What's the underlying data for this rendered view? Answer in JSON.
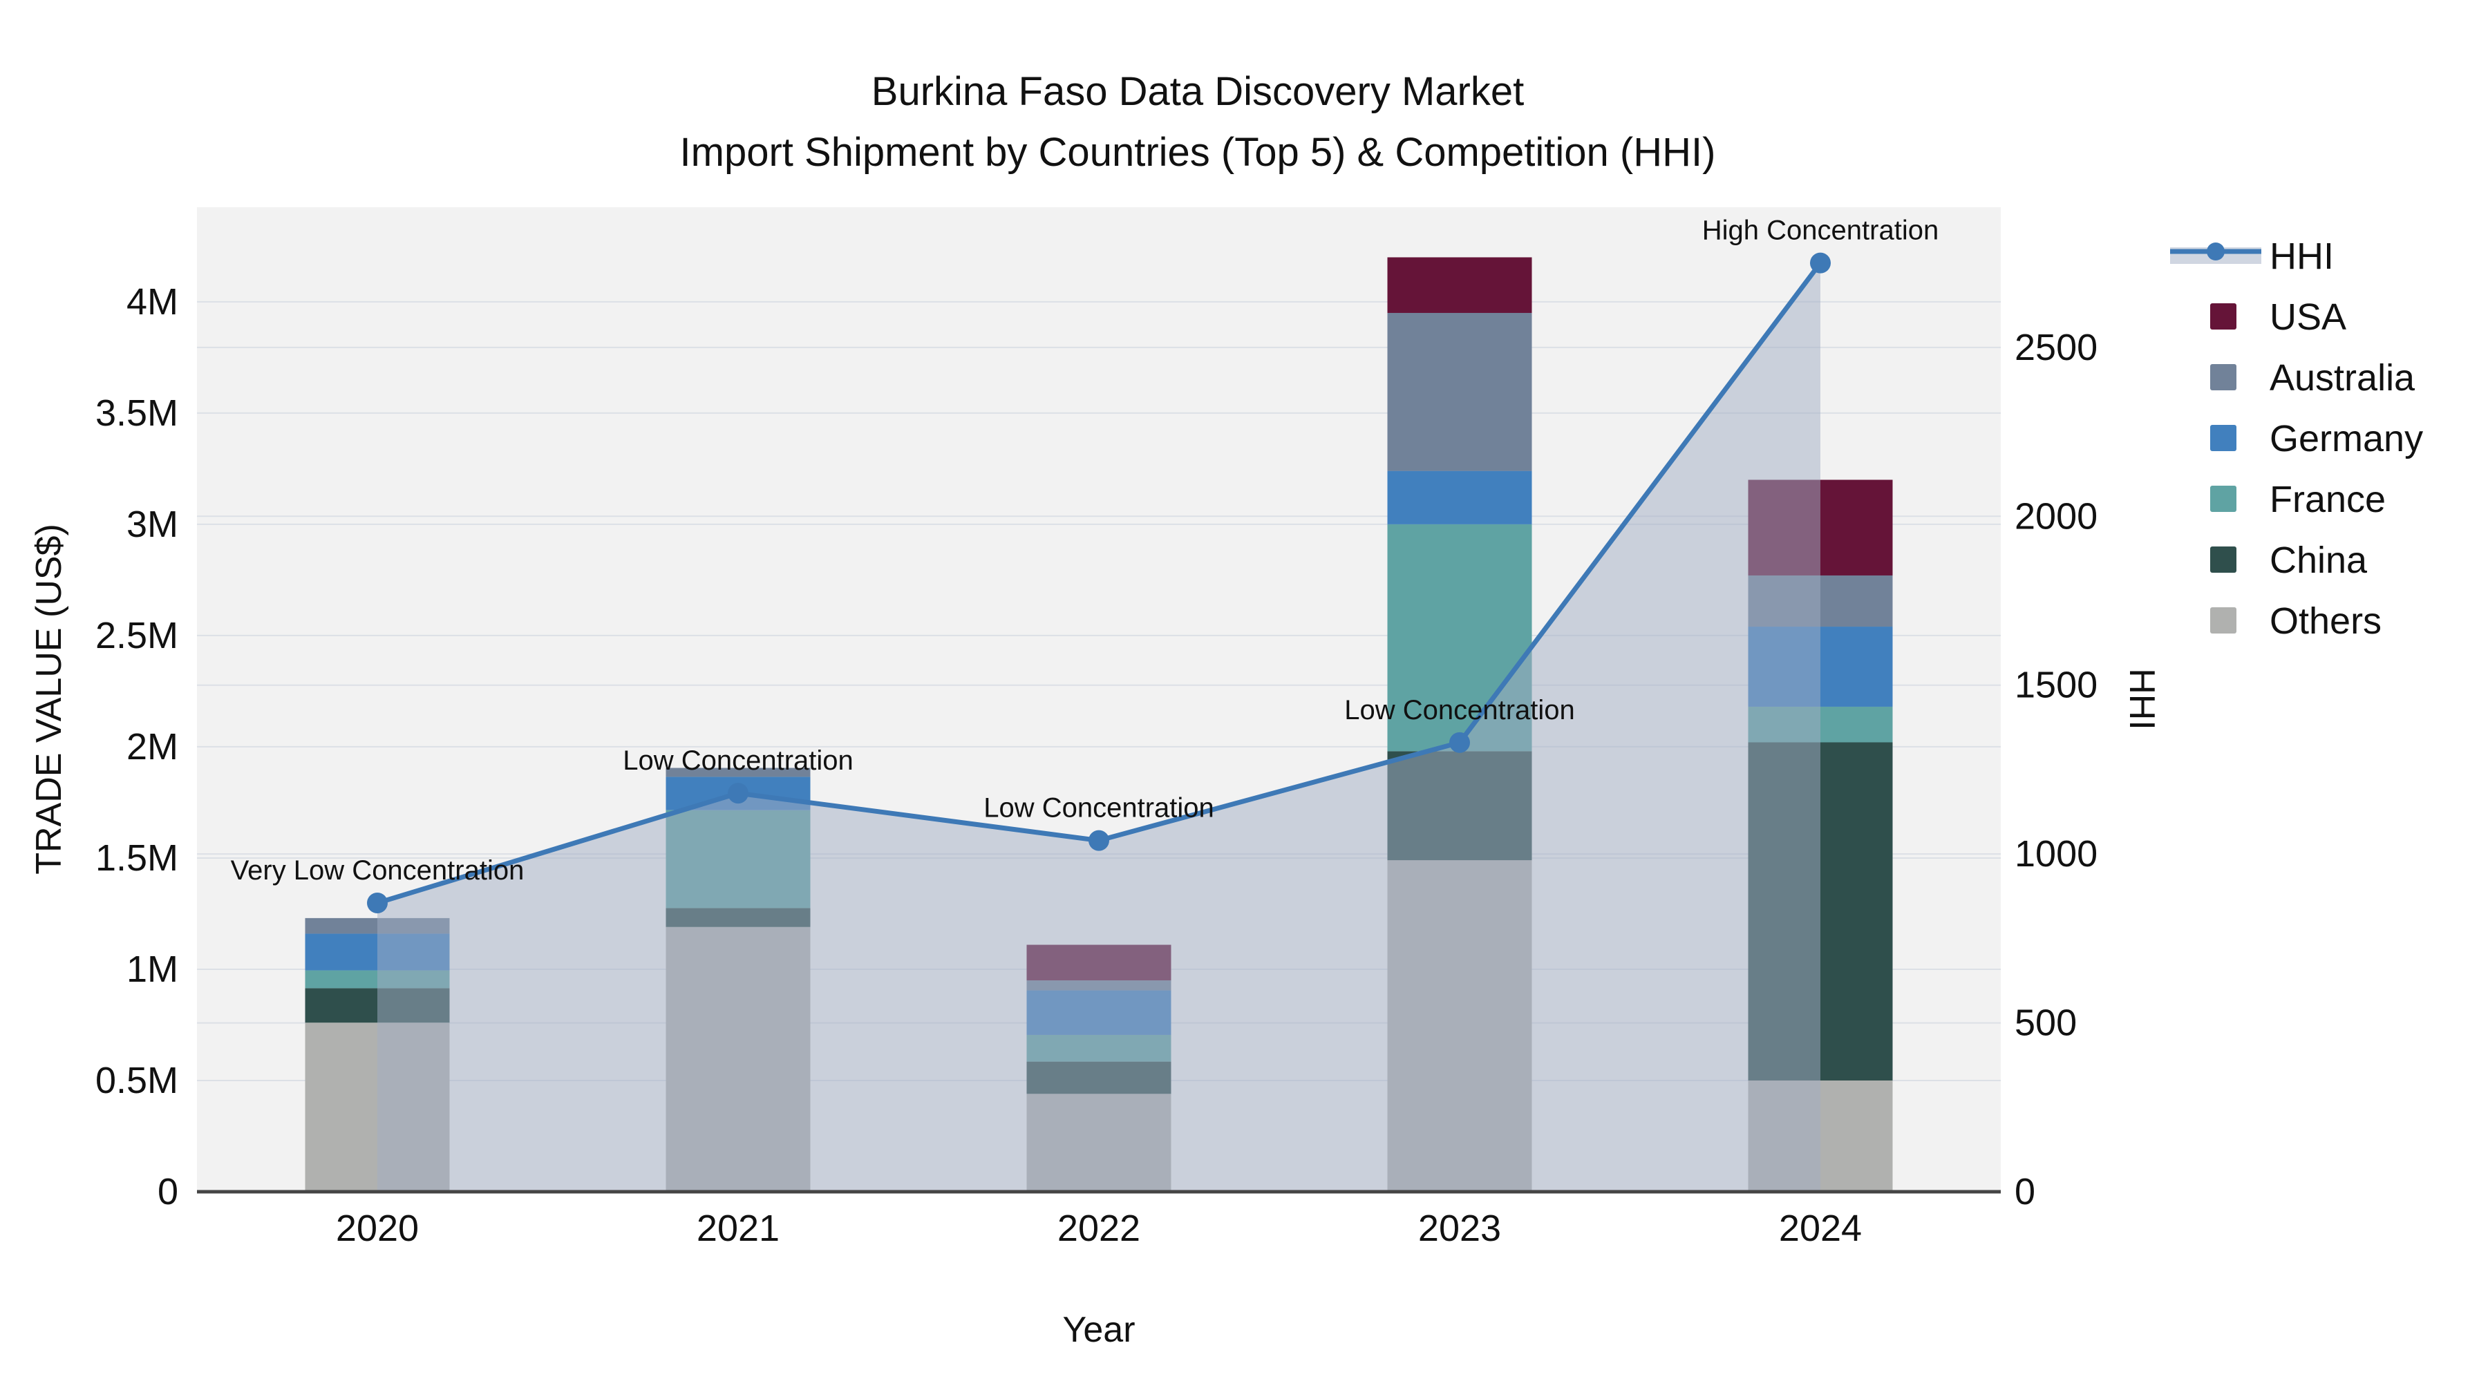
{
  "title": {
    "line1": "Burkina Faso Data Discovery Market",
    "line2": "Import Shipment by Countries (Top 5) & Competition (HHI)"
  },
  "axes": {
    "left": {
      "title": "TRADE VALUE (US$)",
      "tick_labels": [
        "0",
        "0.5M",
        "1M",
        "1.5M",
        "2M",
        "2.5M",
        "3M",
        "3.5M",
        "4M"
      ]
    },
    "right": {
      "title": "HHI",
      "tick_labels": [
        "0",
        "500",
        "1000",
        "1500",
        "2000",
        "2500"
      ]
    },
    "x": {
      "title": "Year",
      "tick_labels": [
        "2020",
        "2021",
        "2022",
        "2023",
        "2024"
      ]
    }
  },
  "legend": {
    "items": [
      {
        "label": "HHI",
        "type": "line",
        "color": "#3E79B6"
      },
      {
        "label": "USA",
        "type": "box",
        "color": "#651438"
      },
      {
        "label": "Australia",
        "type": "box",
        "color": "#718299"
      },
      {
        "label": "Germany",
        "type": "box",
        "color": "#4180BE"
      },
      {
        "label": "France",
        "type": "box",
        "color": "#5FA3A3"
      },
      {
        "label": "China",
        "type": "box",
        "color": "#2F4F4C"
      },
      {
        "label": "Others",
        "type": "box",
        "color": "#B0B1AF"
      }
    ]
  },
  "colors": {
    "plot_bg": "#F2F2F2",
    "grid": "#DCE0E6",
    "axis_line": "#454545",
    "hhi_line": "#3E79B6",
    "hhi_area": "rgba(162,173,195,0.5)",
    "text": "#111111"
  },
  "chart_data": {
    "type": "bar+line",
    "categories": [
      "2020",
      "2021",
      "2022",
      "2023",
      "2024"
    ],
    "bar_unit": "million US$",
    "bar_mode": "stacked",
    "stack_order_bottom_to_top": [
      "Others",
      "China",
      "France",
      "Germany",
      "Australia",
      "USA"
    ],
    "series": [
      {
        "name": "Others",
        "color": "#B0B1AF",
        "values_musd": [
          0.76,
          1.19,
          0.44,
          1.49,
          0.5
        ]
      },
      {
        "name": "China",
        "color": "#2F4F4C",
        "values_musd": [
          0.155,
          0.085,
          0.145,
          0.49,
          1.52
        ]
      },
      {
        "name": "France",
        "color": "#5FA3A3",
        "values_musd": [
          0.08,
          0.44,
          0.12,
          1.02,
          0.16
        ]
      },
      {
        "name": "Germany",
        "color": "#4180BE",
        "values_musd": [
          0.165,
          0.15,
          0.2,
          0.24,
          0.36
        ]
      },
      {
        "name": "Australia",
        "color": "#718299",
        "values_musd": [
          0.07,
          0.04,
          0.045,
          0.71,
          0.23
        ]
      },
      {
        "name": "USA",
        "color": "#651438",
        "values_musd": [
          0,
          0,
          0.16,
          0.25,
          0.43
        ]
      }
    ],
    "bar_totals_musd": [
      1.23,
      1.905,
      1.11,
      4.2,
      3.2
    ],
    "line_series": {
      "name": "HHI",
      "values": [
        855,
        1180,
        1040,
        1330,
        2750
      ],
      "color": "#3E79B6",
      "area_fill": "rgba(162,173,195,0.5)",
      "marker": "circle"
    },
    "point_annotations": [
      "Very Low Concentration",
      "Low Concentration",
      "Low Concentration",
      "Low Concentration",
      "High Concentration"
    ],
    "left_axis": {
      "label": "TRADE VALUE (US$)",
      "range_musd": [
        0,
        4.425
      ],
      "ticks_musd": [
        0,
        0.5,
        1,
        1.5,
        2,
        2.5,
        3,
        3.5,
        4
      ]
    },
    "right_axis": {
      "label": "HHI",
      "range": [
        0,
        2915
      ],
      "ticks": [
        0,
        500,
        1000,
        1500,
        2000,
        2500
      ]
    },
    "x_axis": {
      "label": "Year"
    },
    "grid": true,
    "legend_position": "right"
  }
}
